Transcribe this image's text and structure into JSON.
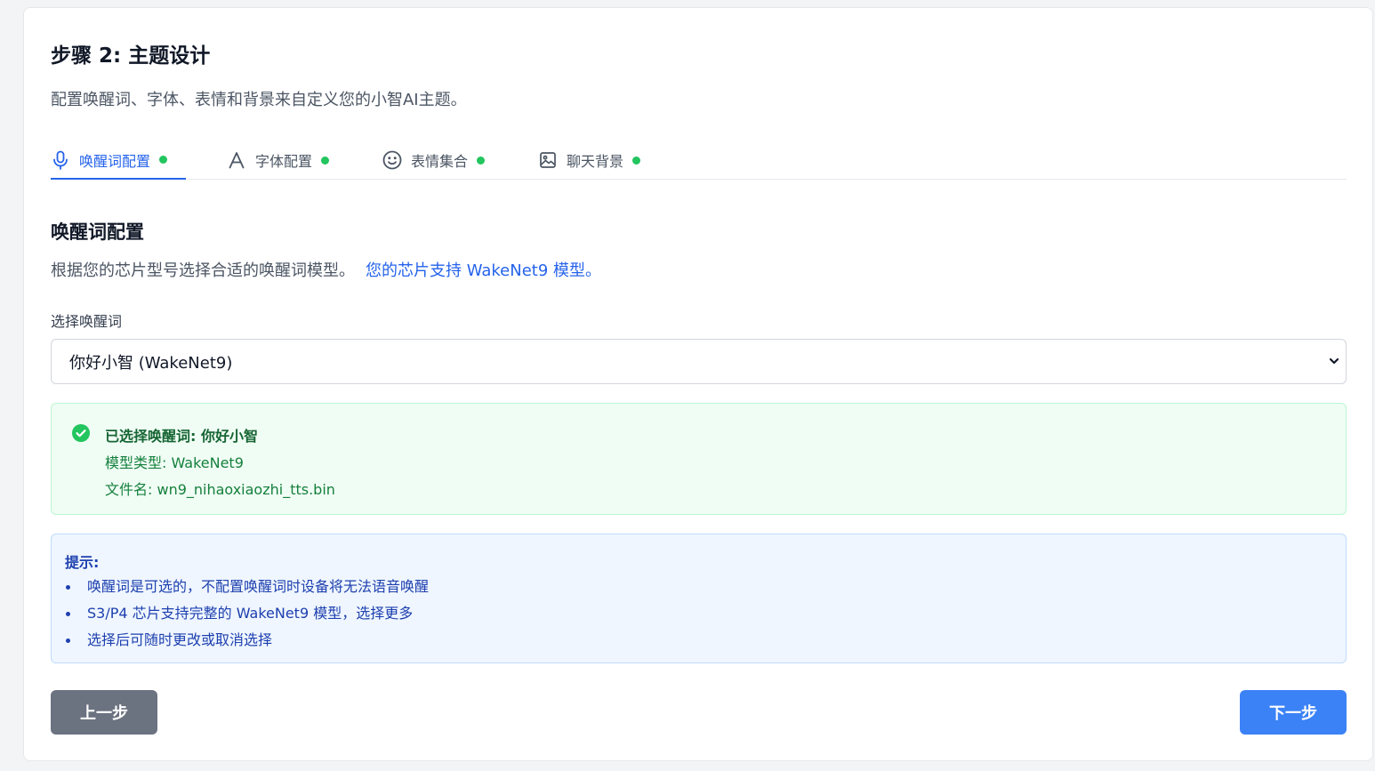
{
  "page": {
    "title": "步骤 2: 主题设计",
    "subtitle": "配置唤醒词、字体、表情和背景来自定义您的小智AI主题。"
  },
  "tabs": [
    {
      "label": "唤醒词配置",
      "icon": "microphone-icon",
      "active": true,
      "status": "complete"
    },
    {
      "label": "字体配置",
      "icon": "font-icon",
      "active": false,
      "status": "complete"
    },
    {
      "label": "表情集合",
      "icon": "smiley-icon",
      "active": false,
      "status": "complete"
    },
    {
      "label": "聊天背景",
      "icon": "image-icon",
      "active": false,
      "status": "complete"
    }
  ],
  "section": {
    "title": "唤醒词配置",
    "description": "根据您的芯片型号选择合适的唤醒词模型。",
    "chip_note": "您的芯片支持 WakeNet9 模型。"
  },
  "wakeword_field": {
    "label": "选择唤醒词",
    "selected": "你好小智 (WakeNet9)"
  },
  "selection_info": {
    "line1": "已选择唤醒词: 你好小智",
    "line2": "模型类型: WakeNet9",
    "line3": "文件名: wn9_nihaoxiaozhi_tts.bin"
  },
  "tips": {
    "title": "提示:",
    "items": [
      "唤醒词是可选的，不配置唤醒词时设备将无法语音唤醒",
      "S3/P4 芯片支持完整的 WakeNet9 模型，选择更多",
      "选择后可随时更改或取消选择"
    ]
  },
  "buttons": {
    "prev": "上一步",
    "next": "下一步"
  },
  "colors": {
    "accent": "#2563eb",
    "status_complete": "#22c55e",
    "success_bg": "#f0fdf4",
    "info_bg": "#eff6ff",
    "prev_button": "#6b7280",
    "next_button": "#3b82f6"
  }
}
